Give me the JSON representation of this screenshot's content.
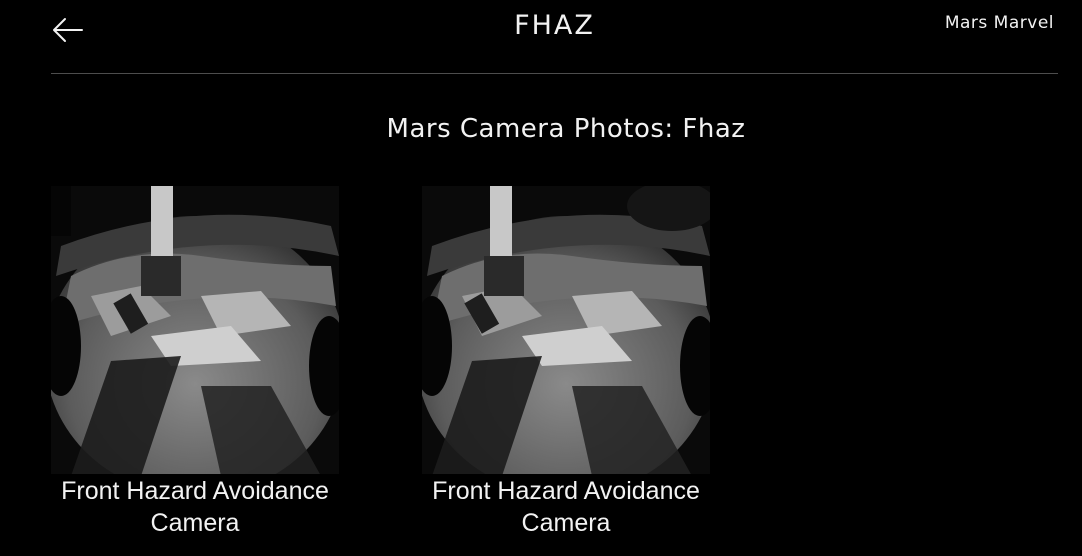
{
  "header": {
    "back_icon": "arrow-left-icon",
    "title": "FHAZ",
    "brand": "Mars Marvel"
  },
  "main": {
    "heading": "Mars Camera Photos: Fhaz",
    "photos": [
      {
        "caption": "Front Hazard Avoidance Camera"
      },
      {
        "caption": "Front Hazard Avoidance Camera"
      }
    ]
  },
  "colors": {
    "background": "#000000",
    "text": "#f2f2f2",
    "divider": "#4d4d4d"
  }
}
